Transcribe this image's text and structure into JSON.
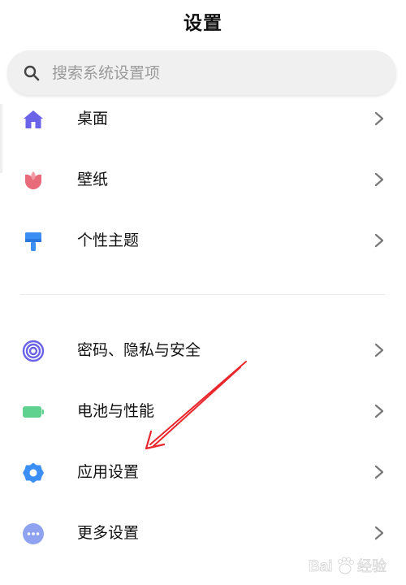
{
  "header": {
    "title": "设置"
  },
  "search": {
    "placeholder": "搜索系统设置项",
    "icon": "search-icon"
  },
  "groups": [
    {
      "items": [
        {
          "label": "桌面",
          "icon": "home-icon",
          "color": "#6a63e8"
        },
        {
          "label": "壁纸",
          "icon": "tulip-icon",
          "color": "#e86b7b"
        },
        {
          "label": "个性主题",
          "icon": "paint-brush-icon",
          "color": "#3b8ef3"
        }
      ]
    },
    {
      "items": [
        {
          "label": "密码、隐私与安全",
          "icon": "fingerprint-icon",
          "color": "#6a63e8"
        },
        {
          "label": "电池与性能",
          "icon": "battery-icon",
          "color": "#5fd28f"
        },
        {
          "label": "应用设置",
          "icon": "gear-icon",
          "color": "#3b8ef3"
        },
        {
          "label": "更多设置",
          "icon": "more-dots-icon",
          "color": "#8ea2f0"
        }
      ]
    }
  ],
  "colors": {
    "annotation_arrow": "#e8262b",
    "chevron": "#777777",
    "search_background": "#f0f0f0"
  },
  "watermark": {
    "text": "Baidu经验",
    "logo": "baidu-paw-logo"
  }
}
